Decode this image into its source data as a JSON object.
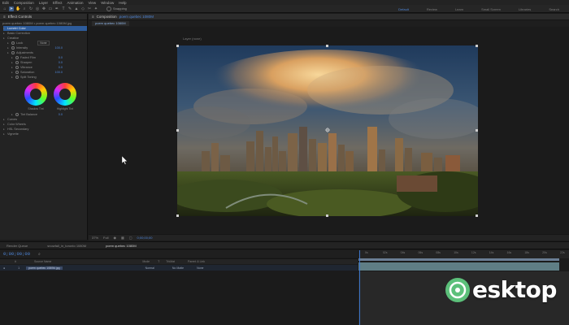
{
  "menu": [
    "Edit",
    "Composition",
    "Layer",
    "Effect",
    "Animation",
    "View",
    "Window",
    "Help"
  ],
  "toolbar": {
    "tools": [
      "home-icon",
      "arrow-icon",
      "hand-icon",
      "zoom-icon",
      "rotate-icon",
      "camera-icon",
      "pan-icon",
      "rect-icon",
      "pen-icon",
      "text-icon",
      "brush-icon",
      "stamp-icon",
      "eraser-icon",
      "roto-icon",
      "puppet-icon"
    ],
    "snapping_label": "Snapping",
    "workspaces": [
      "Default",
      "Review",
      "Learn",
      "Small Screen",
      "Libraries",
      "Search"
    ],
    "active_workspace": "Default"
  },
  "effect_controls": {
    "tab_label": "Effect Controls",
    "path": "poem quebec 1080M • poem quebec 1080M.jpg",
    "rows": [
      {
        "label": "Lumetri Color",
        "indent": 0,
        "selected": true,
        "value": ""
      },
      {
        "label": "Basic Correction",
        "indent": 0,
        "value": ""
      },
      {
        "label": "Creative",
        "indent": 0,
        "value": ""
      },
      {
        "label": "Look",
        "indent": 1,
        "value": "",
        "dropdown": "None"
      },
      {
        "label": "Intensity",
        "indent": 1,
        "value": "100.0"
      },
      {
        "label": "Adjustments",
        "indent": 1,
        "value": ""
      },
      {
        "label": "Faded Film",
        "indent": 2,
        "value": "0.0"
      },
      {
        "label": "Sharpen",
        "indent": 2,
        "value": "0.0"
      },
      {
        "label": "Vibrance",
        "indent": 2,
        "value": "0.0"
      },
      {
        "label": "Saturation",
        "indent": 2,
        "value": "100.0"
      },
      {
        "label": "Split Toning",
        "indent": 2,
        "value": ""
      }
    ],
    "wheel_labels": [
      "Shadow Tint",
      "Highlight Tint"
    ],
    "rows_after": [
      {
        "label": "Tint Balance",
        "indent": 2,
        "value": "0.0"
      },
      {
        "label": "Curves",
        "indent": 0,
        "value": ""
      },
      {
        "label": "Color Wheels",
        "indent": 0,
        "value": ""
      },
      {
        "label": "HSL Secondary",
        "indent": 0,
        "value": ""
      },
      {
        "label": "Vignette",
        "indent": 0,
        "value": ""
      }
    ]
  },
  "composition": {
    "panel_label": "Composition",
    "comp_name": "poem quebec 1080M",
    "tab_label": "poem quebec 1080M",
    "layer_label": "Layer (none)"
  },
  "viewer_bar": {
    "zoom": "37%",
    "resolution": "Full",
    "timecode": "0;00;00;00",
    "items": [
      "Full",
      "Active Camera",
      "1 View"
    ]
  },
  "timeline": {
    "tabs": [
      "Render Queue",
      "snowfall_in_toronto 1080M",
      "poem quebec 1080M"
    ],
    "active_tab": "poem quebec 1080M",
    "timecode": "0;00;00;00",
    "columns": [
      "#",
      "Source Name",
      "Mode",
      "T",
      "TrkMat",
      "Parent & Link"
    ],
    "layer": {
      "index": "1",
      "name": "poem quebec 1080M.jpg",
      "mode": "Normal",
      "trkmat": "No Matte",
      "parent": "None"
    },
    "ruler_marks": [
      "0s",
      "02s",
      "04s",
      "06s",
      "08s",
      "10s",
      "12s",
      "14s",
      "16s",
      "18s",
      "20s",
      "22s"
    ]
  },
  "watermark": {
    "text": "esktop",
    "prefix": "D"
  },
  "colors": {
    "accent": "#4f86d8",
    "selection": "#2d5b9a",
    "watermark": "#5cc07a"
  }
}
